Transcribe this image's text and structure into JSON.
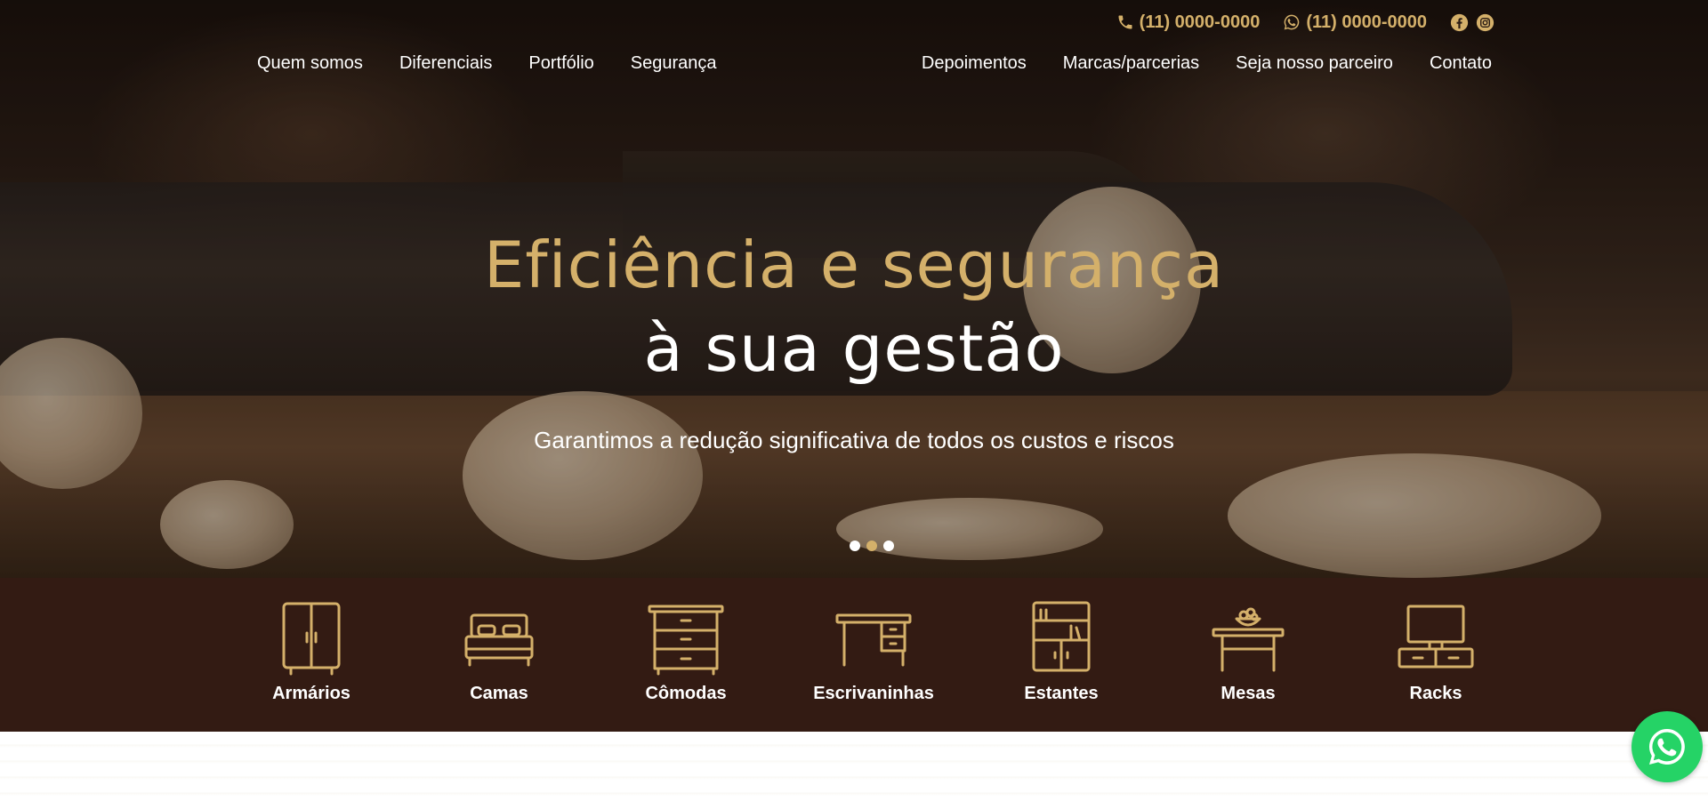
{
  "contact": {
    "phone_1": "(11) 0000-0000",
    "phone_2": "(11) 0000-0000"
  },
  "nav": {
    "left": [
      "Quem somos",
      "Diferenciais",
      "Portfólio",
      "Segurança"
    ],
    "right": [
      "Depoimentos",
      "Marcas/parcerias",
      "Seja nosso parceiro",
      "Contato"
    ]
  },
  "hero": {
    "title_line_1": "Eficiência e segurança",
    "title_line_2": "à sua gestão",
    "subtitle": "Garantimos a redução significativa de todos os custos e riscos",
    "slides_count": 3,
    "active_slide": 2
  },
  "categories": [
    {
      "label": "Armários",
      "icon": "wardrobe-icon"
    },
    {
      "label": "Camas",
      "icon": "bed-icon"
    },
    {
      "label": "Cômodas",
      "icon": "dresser-icon"
    },
    {
      "label": "Escrivaninhas",
      "icon": "desk-icon"
    },
    {
      "label": "Estantes",
      "icon": "bookshelf-icon"
    },
    {
      "label": "Mesas",
      "icon": "table-icon"
    },
    {
      "label": "Racks",
      "icon": "tv-rack-icon"
    }
  ],
  "colors": {
    "accent_gold": "#d4b06a",
    "category_bar": "#331b13",
    "whatsapp": "#25d366"
  }
}
